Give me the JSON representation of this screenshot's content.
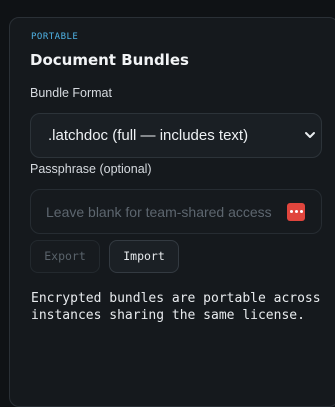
{
  "section": {
    "eyebrow": "PORTABLE",
    "title": "Document Bundles"
  },
  "bundle_format": {
    "label": "Bundle Format",
    "selected": ".latchdoc (full — includes text)",
    "dropdown_icon": "chevron-down-icon"
  },
  "passphrase": {
    "label": "Passphrase (optional)",
    "value": "",
    "placeholder": "Leave blank for team-shared access",
    "password_manager_icon": "password-manager-icon"
  },
  "actions": {
    "export_label": "Export",
    "import_label": "Import"
  },
  "note": "Encrypted bundles are portable across instances sharing the same license.",
  "colors": {
    "accent": "#4fb3e6",
    "panel": "#15191d",
    "password_icon": "#e0453d"
  }
}
